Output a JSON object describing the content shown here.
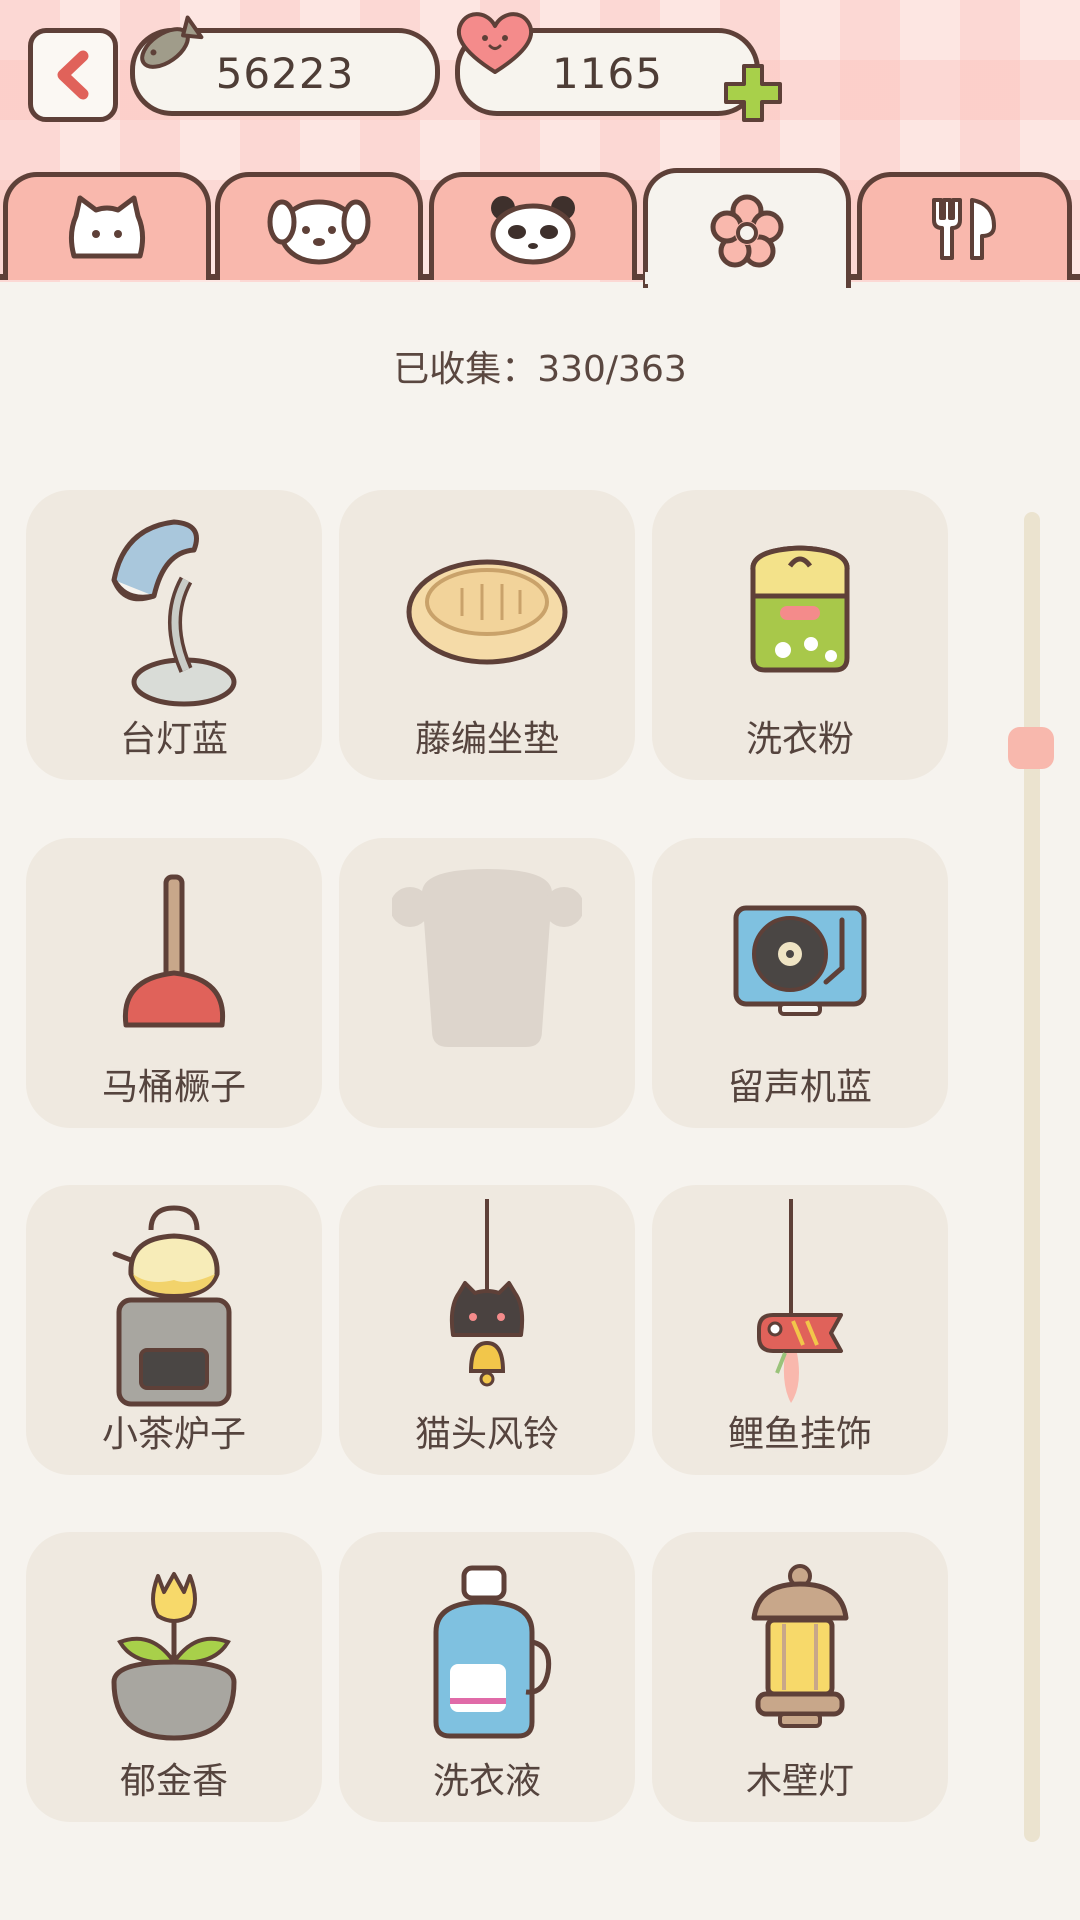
{
  "header": {
    "fish_count": "56223",
    "heart_count": "1165"
  },
  "tabs": [
    {
      "icon": "cat-face-icon"
    },
    {
      "icon": "dog-face-icon"
    },
    {
      "icon": "panda-face-icon"
    },
    {
      "icon": "flower-icon",
      "active": true
    },
    {
      "icon": "fork-spoon-icon"
    }
  ],
  "collection": {
    "count_text": "已收集：330/363"
  },
  "items": [
    {
      "label": "台灯蓝",
      "icon": "desk-lamp-icon"
    },
    {
      "label": "藤编坐垫",
      "icon": "rattan-cushion-icon"
    },
    {
      "label": "洗衣粉",
      "icon": "detergent-powder-icon"
    },
    {
      "label": "马桶橛子",
      "icon": "plunger-icon"
    },
    {
      "label": "",
      "icon": "locked-item-silhouette-icon",
      "locked": true
    },
    {
      "label": "留声机蓝",
      "icon": "record-player-icon"
    },
    {
      "label": "小茶炉子",
      "icon": "tea-stove-icon"
    },
    {
      "label": "猫头风铃",
      "icon": "cat-wind-chime-icon"
    },
    {
      "label": "鲤鱼挂饰",
      "icon": "carp-ornament-icon"
    },
    {
      "label": "郁金香",
      "icon": "tulip-pot-icon"
    },
    {
      "label": "洗衣液",
      "icon": "laundry-liquid-icon"
    },
    {
      "label": "木壁灯",
      "icon": "wooden-lantern-icon"
    }
  ],
  "colors": {
    "background": "#f6f3ee",
    "card": "#efe9e0",
    "tab": "#f9b8ad",
    "outline": "#5e4038",
    "accent_green": "#a8d04a"
  }
}
